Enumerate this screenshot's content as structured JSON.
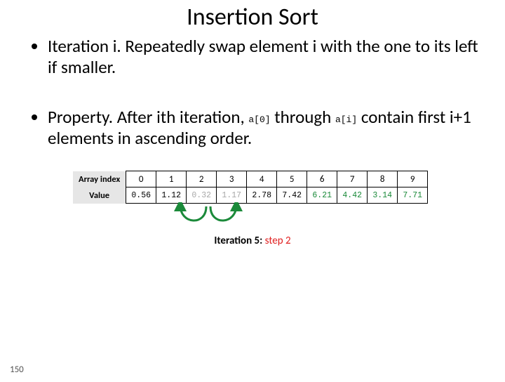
{
  "title": "Insertion Sort",
  "bullets": {
    "b1": "Iteration i.  Repeatedly swap element i with the one to its left if smaller.",
    "b2a": "Property.  After ith iteration, ",
    "b2code1": "a[0]",
    "b2b": " through ",
    "b2code2": "a[i]",
    "b2c": " contain first i+1 elements in ascending order."
  },
  "row_headers": {
    "index": "Array index",
    "value": "Value"
  },
  "indices": [
    "0",
    "1",
    "2",
    "3",
    "4",
    "5",
    "6",
    "7",
    "8",
    "9"
  ],
  "values": [
    "0.56",
    "1.12",
    "0.32",
    "1.17",
    "2.78",
    "7.42",
    "6.21",
    "4.42",
    "3.14",
    "7.71"
  ],
  "value_state": [
    "black",
    "black",
    "grey",
    "grey",
    "black",
    "black",
    "green",
    "green",
    "green",
    "green"
  ],
  "caption": {
    "left": "Iteration 5:",
    "right": " step 2"
  },
  "page_number": "150"
}
